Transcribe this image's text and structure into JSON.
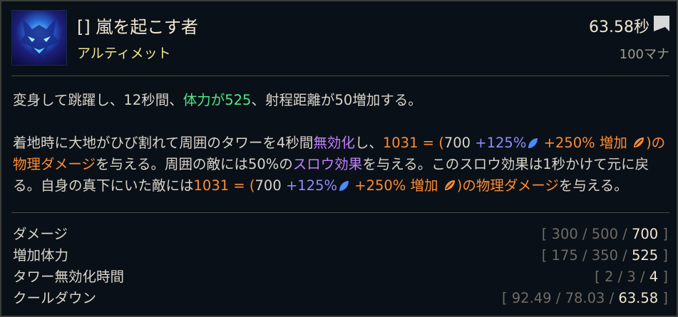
{
  "ability": {
    "icon": "wolf-storm-icon",
    "title": "[] 嵐を起こす者",
    "subtitle": "アルティメット",
    "cooldown": "63.58秒",
    "cost": "100マナ"
  },
  "description": {
    "p1": {
      "a": "変身して跳躍し、12秒間、",
      "b": "体力が525",
      "c": "、射程距離が50増加する。"
    },
    "p2": {
      "a": "着地時に大地がひび割れて周囲のタワーを4秒間",
      "b": "無効化",
      "c": "し、",
      "d": "1031 = (",
      "e": "700",
      "f": "+125%",
      "g": "+250% 増加",
      "h": ")の物理ダメージ",
      "i": "を与える。周囲の敵には50%の",
      "j": "スロウ効果",
      "k": "を与える。このスロウ効果は1秒かけて元に戻る。自身の真下にいた敵には",
      "l": "1031 = (",
      "m": "700",
      "n": "+125%",
      "o": "+250% 増加",
      "p": ")の物理ダメージ",
      "q": "を与える。"
    }
  },
  "stats": [
    {
      "label": "ダメージ",
      "open": "[ ",
      "v1": "300",
      "s1": " / ",
      "v2": "500",
      "s2": " / ",
      "v3": "700",
      "close": " ]"
    },
    {
      "label": "増加体力",
      "open": "[ ",
      "v1": "175",
      "s1": " / ",
      "v2": "350",
      "s2": " / ",
      "v3": "525",
      "close": " ]"
    },
    {
      "label": "タワー無効化時間",
      "open": "[ ",
      "v1": "2",
      "s1": " / ",
      "v2": "3",
      "s2": " / ",
      "v3": "4",
      "close": " ]"
    },
    {
      "label": "クールダウン",
      "open": "[ ",
      "v1": "92.49",
      "s1": " / ",
      "v2": "78.03",
      "s2": " / ",
      "v3": "63.58",
      "close": " ]"
    }
  ],
  "colors": {
    "health": "#4ce98b",
    "status": "#c080ff",
    "physical": "#ff8c34",
    "ap_ratio": "#8c8cff"
  }
}
